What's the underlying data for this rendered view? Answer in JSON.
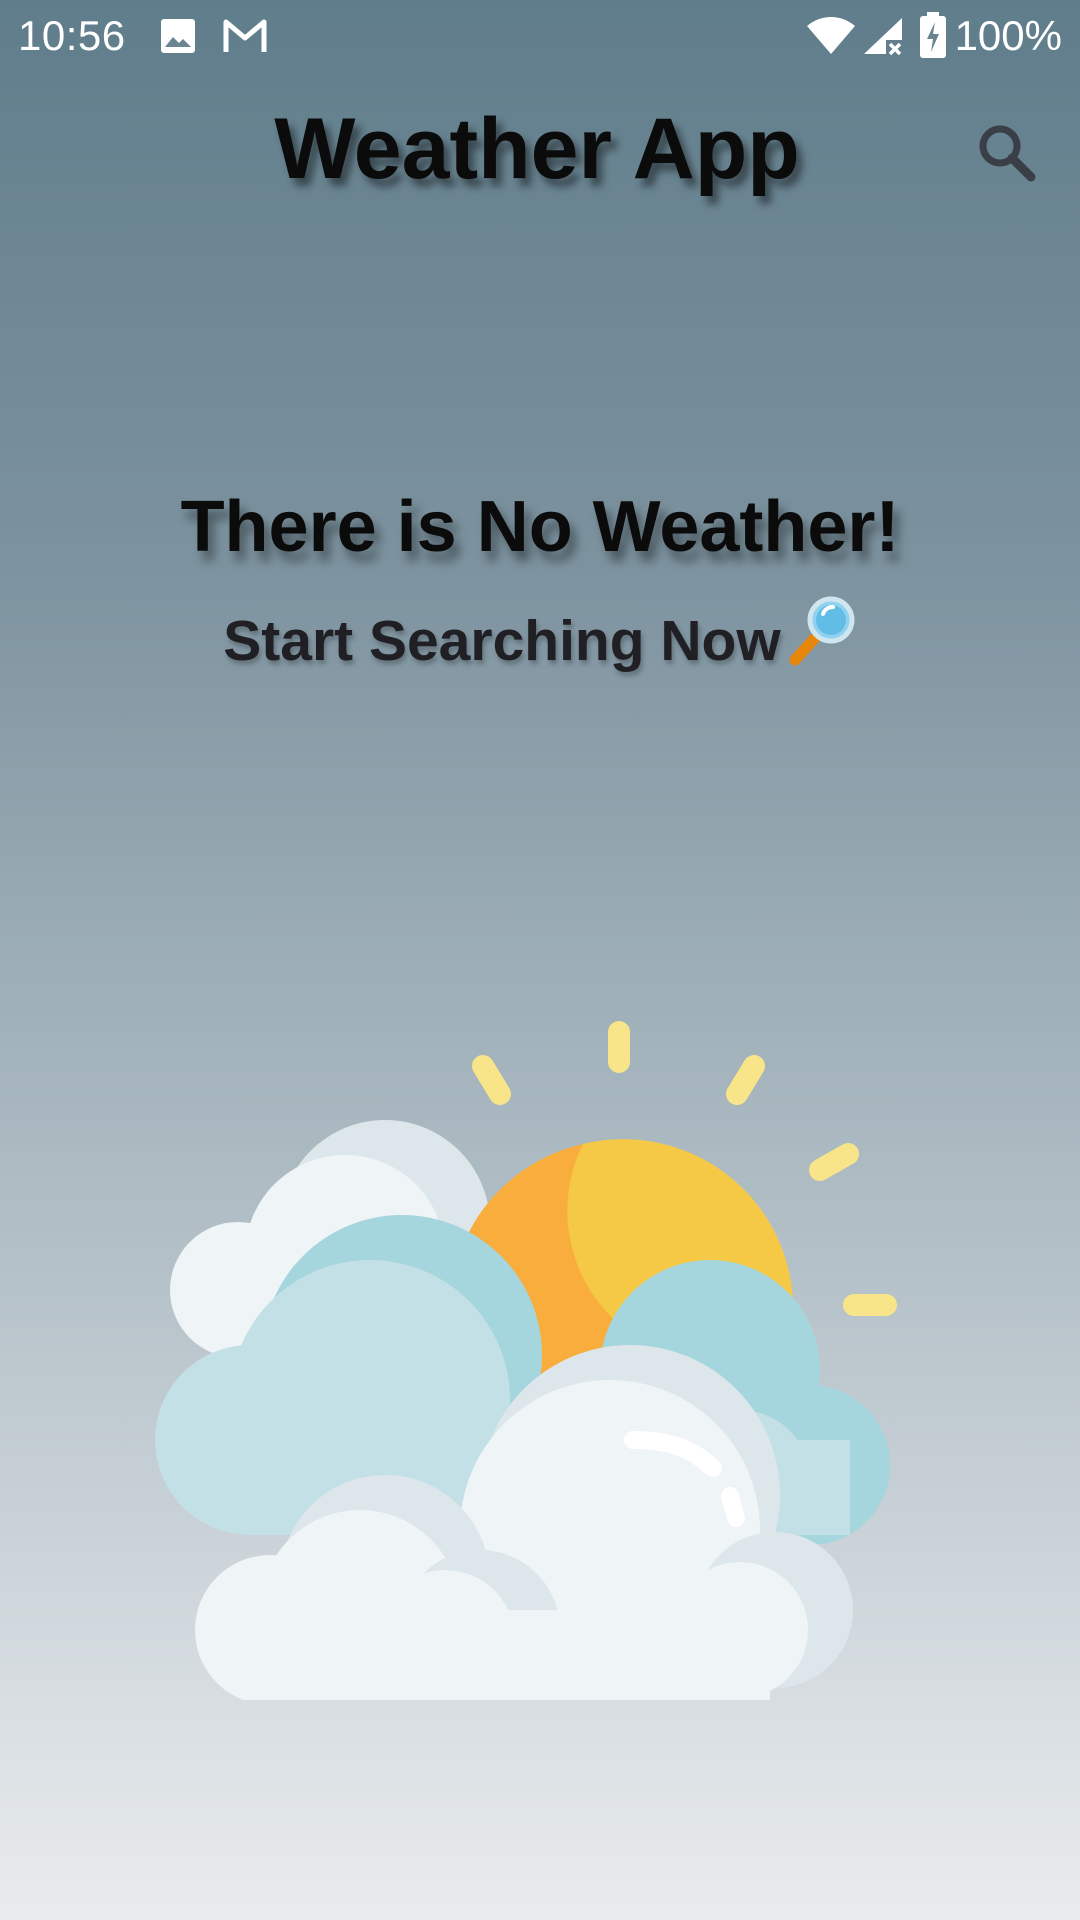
{
  "status_bar": {
    "time": "10:56",
    "battery_percent": "100%",
    "icons": [
      "image-icon",
      "gmail-icon",
      "wifi-icon",
      "cell-signal-off-icon",
      "battery-charging-icon"
    ]
  },
  "app_bar": {
    "title": "Weather App",
    "search_icon": "search-icon"
  },
  "empty_state": {
    "title": "There is No Weather!",
    "subtitle": "Start Searching Now",
    "subtitle_icon": "magnifier-emoji",
    "illustration": "sun-behind-clouds-illustration"
  },
  "colors": {
    "background_top": "#607d8b",
    "background_bottom": "#e9ecee",
    "sun_orange": "#f8ad3c",
    "sun_yellow": "#f5c945",
    "sun_rays": "#f8e589",
    "cloud_white": "#eff4f6",
    "cloud_blue": "#c3e0e6",
    "cloud_shadow": "#dde7eb"
  }
}
